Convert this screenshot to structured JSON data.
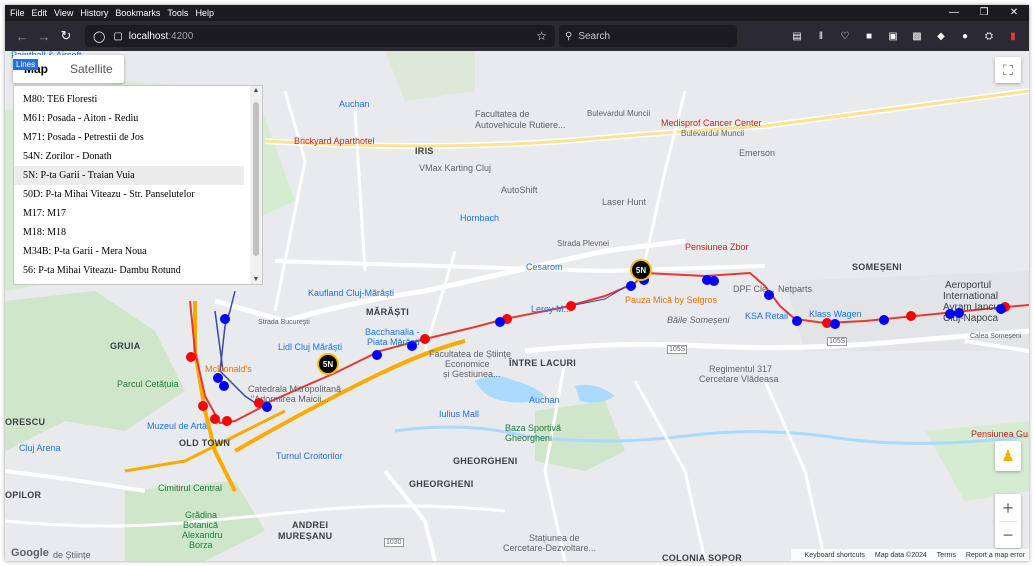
{
  "browser": {
    "menu": [
      "File",
      "Edit",
      "View",
      "History",
      "Bookmarks",
      "Tools",
      "Help"
    ],
    "url_host": "localhost",
    "url_port": ":4200",
    "search_placeholder": "Search"
  },
  "map": {
    "type_control": {
      "map_label": "Map",
      "satellite_label": "Satellite",
      "active": "Map"
    },
    "lines_badge": "Lines",
    "lines": [
      "M80: TE6 Floresti",
      "M61: Posada - Aiton - Rediu",
      "M71: Posada - Petrestii de Jos",
      "54N: Zorilor - Donath",
      "5N: P-ta Garii - Traian Vuia",
      "50D: P-ta Mihai Viteazu - Str. Panselutelor",
      "M17: M17",
      "M18: M18",
      "M34B: P-ta Garii - Mera Noua",
      "56: P-ta Mihai Viteazu- Dambu Rotund"
    ],
    "selected_line": "5N: P-ta Garii - Traian Vuia",
    "bus_label": "5N",
    "labels": {
      "paintball": "Paintball & Airsoft",
      "auchan_n": "Auchan",
      "facultatea_auto": "Facultatea de",
      "facultatea_auto2": "Autovehicule Rutiere...",
      "bulevardul_muncii": "Bulevardul Muncii",
      "bulevardul_muncii2": "Bulevardul Muncii",
      "medisprof": "Medisprof Cancer Center",
      "brickyard": "Brickyard Aparthotel",
      "iris": "IRIS",
      "vmax": "VMax Karting Cluj",
      "emerson": "Emerson",
      "autoshift": "AutoShift",
      "laserhunt": "Laser Hunt",
      "hornbach": "Hornbach",
      "strada_plevnei": "Strada Plevnei",
      "pensiunea_zbor": "Pensiunea Zbor",
      "cesarom": "Cesarom",
      "somesenii": "SOMEȘENI",
      "netparts": "Netparts",
      "aeroport1": "Aeroportul",
      "aeroport2": "International",
      "aeroport3": "Avram Iancu",
      "aeroport4": "Cluj-Napoca",
      "kaufland": "Kaufland Cluj-Mărăști",
      "marasti": "MĂRĂȘTI",
      "leroy": "Leroy M...",
      "pauza": "Pauza Mică by Selgros",
      "dpf": "DPF Cle...",
      "klass": "Klass Wagen",
      "ksa": "KSA Retail",
      "baile": "Băile Someșeni",
      "bacchanalia1": "Bacchanalia -",
      "bacchanalia2": "Piata Mărăști",
      "lidl": "Lidl Cluj Mărăști",
      "gruia": "GRUIA",
      "mcdonalds": "McDonald's",
      "facultatea_ec1": "Facultatea de Științe",
      "facultatea_ec2": "Economice",
      "facultatea_ec3": "și Gestiunea...",
      "intre_lacuri": "ÎNTRE LACURI",
      "regiment1": "Regimentul 317",
      "regiment2": "Cercetare Vlădeasa",
      "parcul": "Parcul Cetățuia",
      "catedrala1": "Catedrala Mitropolitană",
      "catedrala2": "\"Adormirea Maicii...",
      "iulius": "Iulius Mall",
      "auchan_s": "Auchan",
      "muzeul": "Muzeul de Artă",
      "old_town": "OLD TOWN",
      "baza1": "Baza Sportivă",
      "baza2": "Gheorgheni",
      "cluj_arena": "Cluj Arena",
      "turnul": "Turnul Croitorilor",
      "gheorgheni1": "GHEORGHENI",
      "gheorgheni2": "GHEORGHENI",
      "cimitirul": "Cimitirul Central",
      "gradina1": "Grădina",
      "gradina2": "Botanică",
      "gradina3": "Alexandru",
      "gradina4": "Borza",
      "andrei1": "ANDREI",
      "andrei2": "MUREȘANU",
      "statiunea1": "Stațiunea de",
      "statiunea2": "Cercetare-Dezvoltare...",
      "colonia": "COLONIA SOPOR",
      "pensiunea_gu": "Pensiunea Gu",
      "sorescu": "ORESCU",
      "opilor": "OPILOR",
      "stiinte": "de Științe",
      "strada_bucuresti": "Strada Bucureşti",
      "calea_someseni": "Calea Someșeni",
      "r105a": "105S",
      "r105b": "105S",
      "r1030": "1030"
    },
    "footer": {
      "shortcuts": "Keyboard shortcuts",
      "mapdata": "Map data ©2024",
      "terms": "Terms",
      "report": "Report a map error"
    },
    "google": "Google",
    "colors": {
      "route_line": "#e53935",
      "route_branch": "#3949ab",
      "stop_red": "#ff0000",
      "stop_blue": "#0000ff"
    }
  }
}
